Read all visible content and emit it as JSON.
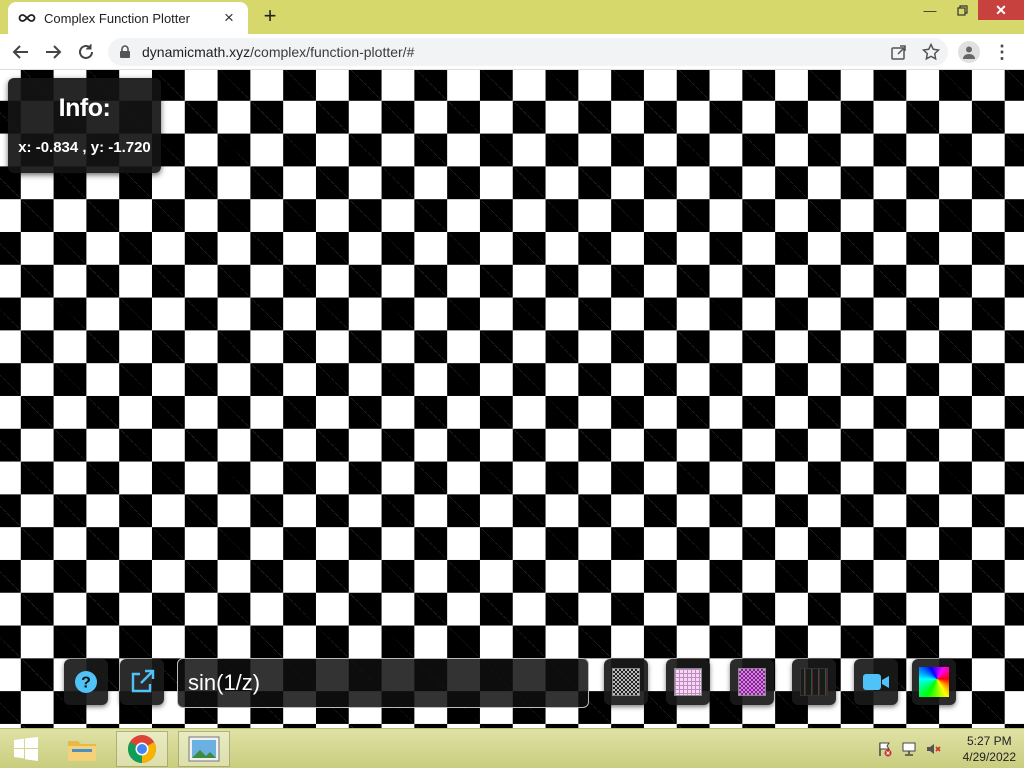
{
  "browser": {
    "tab_title": "Complex Function Plotter",
    "url_host": "dynamicmath.xyz",
    "url_path": "/complex/function-plotter/#"
  },
  "info": {
    "title": "Info:",
    "coords": "x: -0.834 , y: -1.720"
  },
  "controls": {
    "function_value": "sin(1/z)",
    "help_icon": "question-circle-icon",
    "external_icon": "external-link-icon",
    "video_icon": "video-camera-icon",
    "accent_color": "#4fc3f7"
  },
  "taskbar": {
    "time": "5:27 PM",
    "date": "4/29/2022"
  }
}
